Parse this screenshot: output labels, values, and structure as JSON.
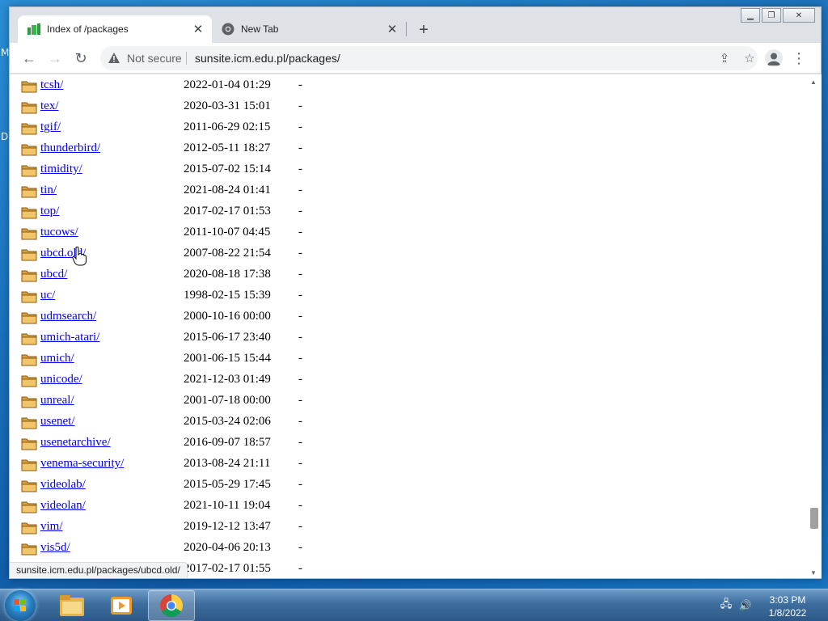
{
  "browser": {
    "tabs": [
      {
        "title": "Index of /packages",
        "icon": "sunsite-favicon",
        "active": true
      },
      {
        "title": "New Tab",
        "icon": "chrome-icon",
        "active": false
      }
    ],
    "security_label": "Not secure",
    "url": "sunsite.icm.edu.pl/packages/",
    "status_url": "sunsite.icm.edu.pl/packages/ubcd.old/"
  },
  "desktop": {
    "glyphs": [
      "M",
      "D"
    ]
  },
  "listing": [
    {
      "name": "tcsh/",
      "date": "2022-01-04 01:29",
      "size": "-"
    },
    {
      "name": "tex/",
      "date": "2020-03-31 15:01",
      "size": "-"
    },
    {
      "name": "tgif/",
      "date": "2011-06-29 02:15",
      "size": "-"
    },
    {
      "name": "thunderbird/",
      "date": "2012-05-11 18:27",
      "size": "-"
    },
    {
      "name": "timidity/",
      "date": "2015-07-02 15:14",
      "size": "-"
    },
    {
      "name": "tin/",
      "date": "2021-08-24 01:41",
      "size": "-"
    },
    {
      "name": "top/",
      "date": "2017-02-17 01:53",
      "size": "-"
    },
    {
      "name": "tucows/",
      "date": "2011-10-07 04:45",
      "size": "-"
    },
    {
      "name": "ubcd.old/",
      "date": "2007-08-22 21:54",
      "size": "-"
    },
    {
      "name": "ubcd/",
      "date": "2020-08-18 17:38",
      "size": "-"
    },
    {
      "name": "uc/",
      "date": "1998-02-15 15:39",
      "size": "-"
    },
    {
      "name": "udmsearch/",
      "date": "2000-10-16 00:00",
      "size": "-"
    },
    {
      "name": "umich-atari/",
      "date": "2015-06-17 23:40",
      "size": "-"
    },
    {
      "name": "umich/",
      "date": "2001-06-15 15:44",
      "size": "-"
    },
    {
      "name": "unicode/",
      "date": "2021-12-03 01:49",
      "size": "-"
    },
    {
      "name": "unreal/",
      "date": "2001-07-18 00:00",
      "size": "-"
    },
    {
      "name": "usenet/",
      "date": "2015-03-24 02:06",
      "size": "-"
    },
    {
      "name": "usenetarchive/",
      "date": "2016-09-07 18:57",
      "size": "-"
    },
    {
      "name": "venema-security/",
      "date": "2013-08-24 21:11",
      "size": "-"
    },
    {
      "name": "videolab/",
      "date": "2015-05-29 17:45",
      "size": "-"
    },
    {
      "name": "videolan/",
      "date": "2021-10-11 19:04",
      "size": "-"
    },
    {
      "name": "vim/",
      "date": "2019-12-12 13:47",
      "size": "-"
    },
    {
      "name": "vis5d/",
      "date": "2020-04-06 20:13",
      "size": "-"
    },
    {
      "name": "",
      "date": "2017-02-17 01:55",
      "size": "-"
    }
  ],
  "taskbar": {
    "apps": [
      "file-explorer-icon",
      "media-player-icon",
      "chrome-icon"
    ],
    "time": "3:03 PM",
    "date": "1/8/2022"
  },
  "colors": {
    "link": "#0000ee",
    "folder": "#e8b04a",
    "taskbar": "#3e6e9e"
  }
}
